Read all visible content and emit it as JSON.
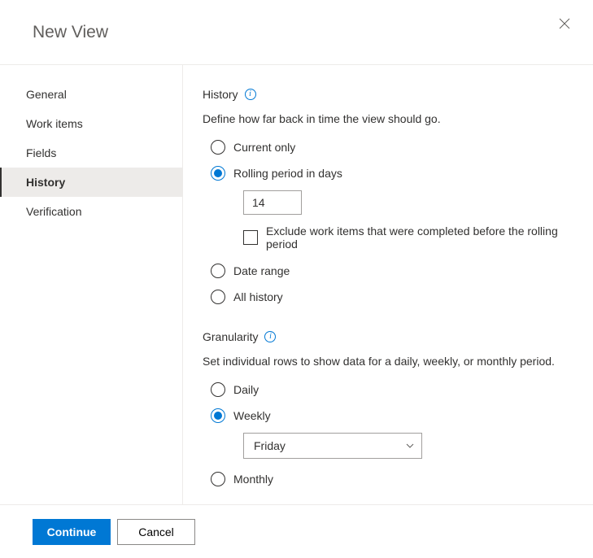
{
  "header": {
    "title": "New View"
  },
  "sidebar": {
    "items": [
      {
        "label": "General",
        "selected": false
      },
      {
        "label": "Work items",
        "selected": false
      },
      {
        "label": "Fields",
        "selected": false
      },
      {
        "label": "History",
        "selected": true
      },
      {
        "label": "Verification",
        "selected": false
      }
    ]
  },
  "history": {
    "heading": "History",
    "description": "Define how far back in time the view should go.",
    "options": {
      "current_only": "Current only",
      "rolling": "Rolling period in days",
      "date_range": "Date range",
      "all_history": "All history"
    },
    "selected": "rolling",
    "rolling_value": "14",
    "exclude_label": "Exclude work items that were completed before the rolling period",
    "exclude_checked": false
  },
  "granularity": {
    "heading": "Granularity",
    "description": "Set individual rows to show data for a daily, weekly, or monthly period.",
    "options": {
      "daily": "Daily",
      "weekly": "Weekly",
      "monthly": "Monthly"
    },
    "selected": "weekly",
    "weekly_day": "Friday"
  },
  "footer": {
    "continue": "Continue",
    "cancel": "Cancel"
  }
}
